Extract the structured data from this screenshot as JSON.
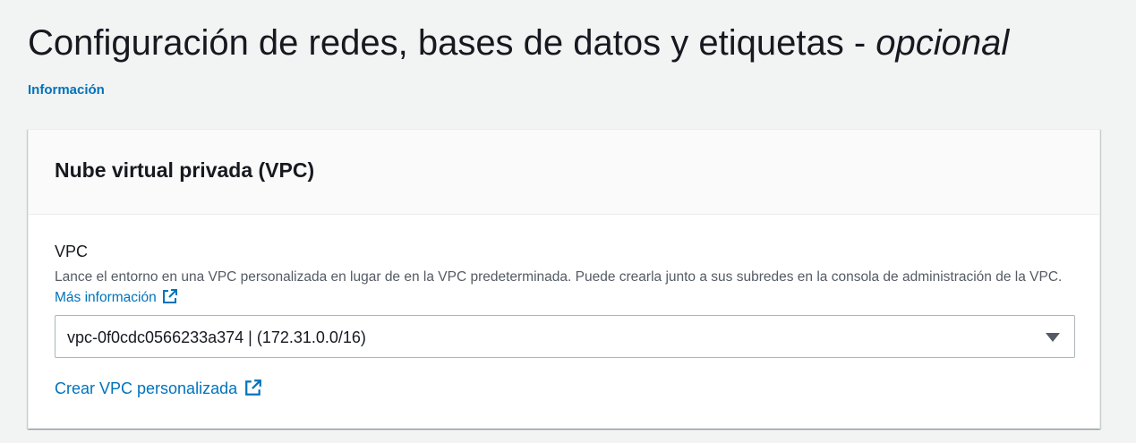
{
  "header": {
    "title_main": "Configuración de redes, bases de datos y etiquetas - ",
    "title_optional": "opcional",
    "info_link": "Información"
  },
  "vpc_section": {
    "title": "Nube virtual privada (VPC)",
    "field_label": "VPC",
    "description": "Lance el entorno en una VPC personalizada en lugar de en la VPC predeterminada. Puede crearla junto a sus subredes en la consola de administración de la VPC.",
    "learn_more_link": "Más información",
    "selected_vpc": "vpc-0f0cdc0566233a374 | (172.31.0.0/16)",
    "create_vpc_link": "Crear VPC personalizada"
  },
  "colors": {
    "link": "#0073bb",
    "text": "#16191f",
    "secondary_text": "#545b64",
    "background": "#f2f3f3"
  },
  "icons": [
    "external-link-icon",
    "caret-down-icon"
  ]
}
